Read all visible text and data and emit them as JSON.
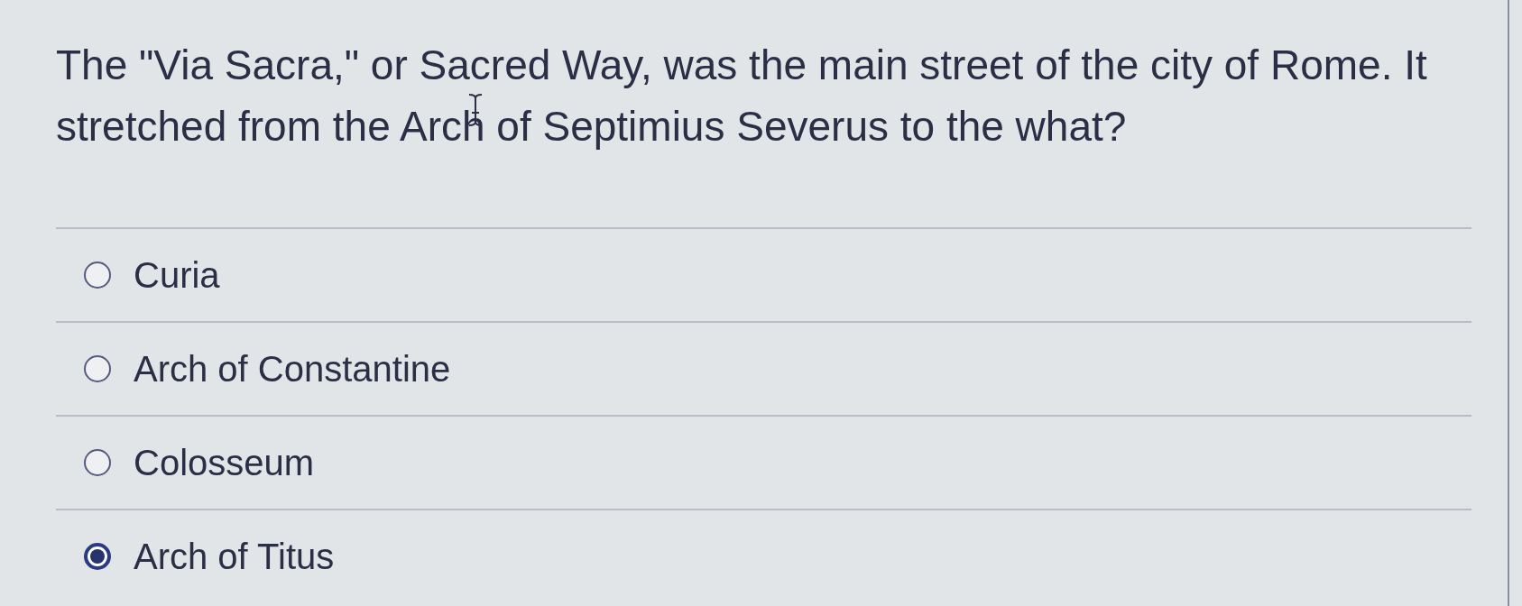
{
  "question": {
    "text": "The \"Via Sacra,\" or Sacred Way, was the main street of the city of Rome. It stretched from the Arch of Septimius Severus to the what?"
  },
  "options": [
    {
      "label": "Curia",
      "selected": false
    },
    {
      "label": "Arch of Constantine",
      "selected": false
    },
    {
      "label": "Colosseum",
      "selected": false
    },
    {
      "label": "Arch of Titus",
      "selected": true
    }
  ]
}
